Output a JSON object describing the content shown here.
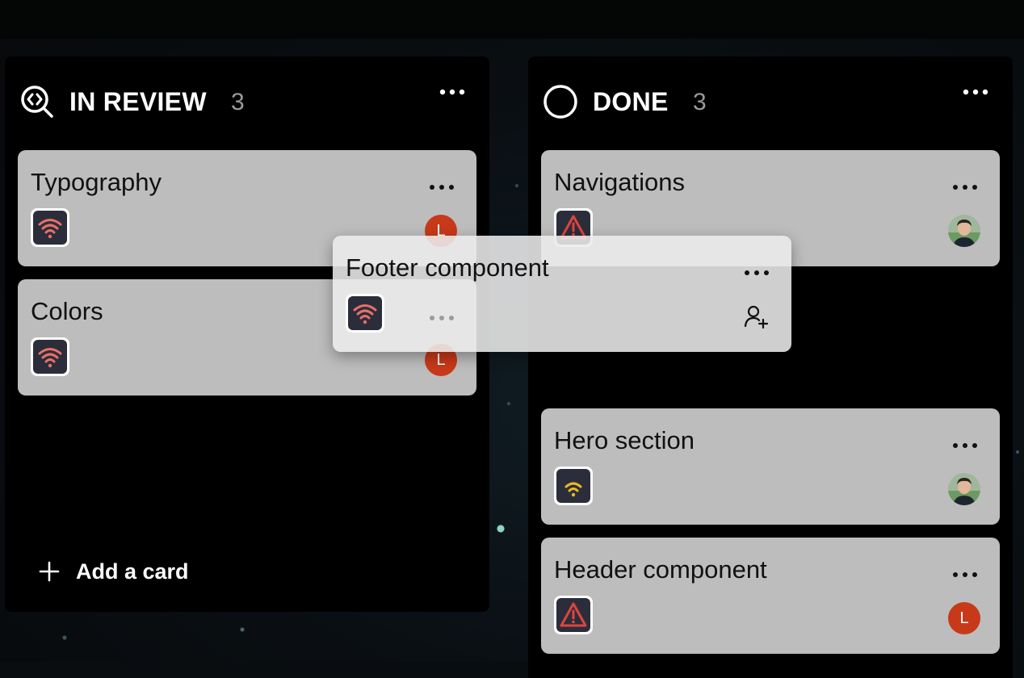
{
  "columns": [
    {
      "id": "in-review",
      "title": "IN REVIEW",
      "count": "3",
      "icon": "code-search-icon",
      "add_card_label": "Add a card",
      "cards": [
        {
          "title": "Typography",
          "icon": "wifi-icon",
          "icon_color": "#e8706a",
          "assignee_initial": "L"
        },
        {
          "title": "Colors",
          "icon": "wifi-icon",
          "icon_color": "#e8706a",
          "assignee_initial": "L"
        }
      ]
    },
    {
      "id": "done",
      "title": "DONE",
      "count": "3",
      "icon": "circle-icon",
      "cards": [
        {
          "title": "Navigations",
          "icon": "warning-icon",
          "icon_color": "#e0443f",
          "assignee": "photo-avatar"
        },
        {
          "title": "Hero section",
          "icon": "wifi-icon",
          "icon_color": "#e8b828",
          "assignee": "photo-avatar"
        },
        {
          "title": "Header component",
          "icon": "warning-icon",
          "icon_color": "#e0443f",
          "assignee_initial": "L"
        }
      ]
    }
  ],
  "dragging_card": {
    "title": "Footer component",
    "icon": "wifi-icon",
    "icon_color": "#e8706a",
    "action_icon": "add-user-icon"
  },
  "colors": {
    "card": "#bdbdbd",
    "column": "#000000",
    "avatar": "#c8391a",
    "priority_high": "#e8706a",
    "priority_medium": "#e8b828",
    "warning": "#e0443f"
  }
}
